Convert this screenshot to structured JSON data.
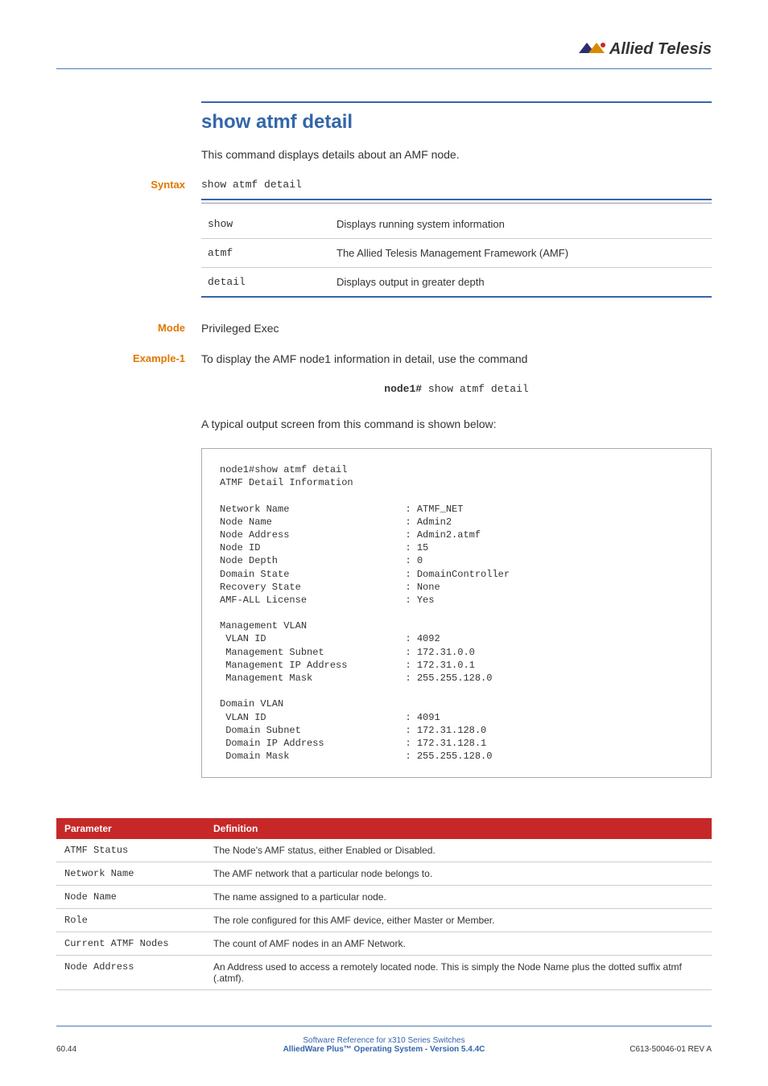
{
  "logo_text": "Allied Telesis",
  "heading": "show atmf detail",
  "intro": "This command displays details about an AMF node.",
  "syntax": {
    "label": "Syntax",
    "code": "show atmf detail",
    "rows": [
      {
        "cmd": "show",
        "desc": "Displays running system information"
      },
      {
        "cmd": "atmf",
        "desc": "The Allied Telesis Management Framework (AMF)"
      },
      {
        "cmd": "detail",
        "desc": "Displays output in greater depth"
      }
    ]
  },
  "mode": {
    "label": "Mode",
    "value": "Privileged Exec"
  },
  "example": {
    "label": "Example-1",
    "text": "To display the AMF node1 information in detail, use the command",
    "prompt": "node1#",
    "cmd": " show atmf detail",
    "followup": "A typical output screen from this command is shown below:"
  },
  "output": "node1#show atmf detail\nATMF Detail Information\n\nNetwork Name                    : ATMF_NET\nNode Name                       : Admin2\nNode Address                    : Admin2.atmf\nNode ID                         : 15\nNode Depth                      : 0\nDomain State                    : DomainController\nRecovery State                  : None\nAMF-ALL License                 : Yes\n\nManagement VLAN\n VLAN ID                        : 4092\n Management Subnet              : 172.31.0.0\n Management IP Address          : 172.31.0.1\n Management Mask                : 255.255.128.0\n\nDomain VLAN\n VLAN ID                        : 4091\n Domain Subnet                  : 172.31.128.0\n Domain IP Address              : 172.31.128.1\n Domain Mask                    : 255.255.128.0\n",
  "def_table": {
    "headers": {
      "p": "Parameter",
      "d": "Definition"
    },
    "rows": [
      {
        "p": "ATMF Status",
        "d": "The Node's AMF status, either Enabled or Disabled."
      },
      {
        "p": "Network Name",
        "d": "The AMF network that a particular node belongs to."
      },
      {
        "p": "Node Name",
        "d": "The name assigned to a particular node."
      },
      {
        "p": "Role",
        "d": "The role configured for this AMF device, either Master or Member."
      },
      {
        "p": "Current ATMF Nodes",
        "d": "The count of AMF nodes in an AMF Network."
      },
      {
        "p": "Node Address",
        "d": "An Address used to access a remotely located node. This is simply the Node Name plus the dotted suffix atmf  (.atmf)."
      }
    ]
  },
  "footer": {
    "line1": "Software Reference for x310 Series Switches",
    "line2": "AlliedWare Plus™ Operating System  - Version 5.4.4C",
    "left": "60.44",
    "right": "C613-50046-01 REV A"
  }
}
